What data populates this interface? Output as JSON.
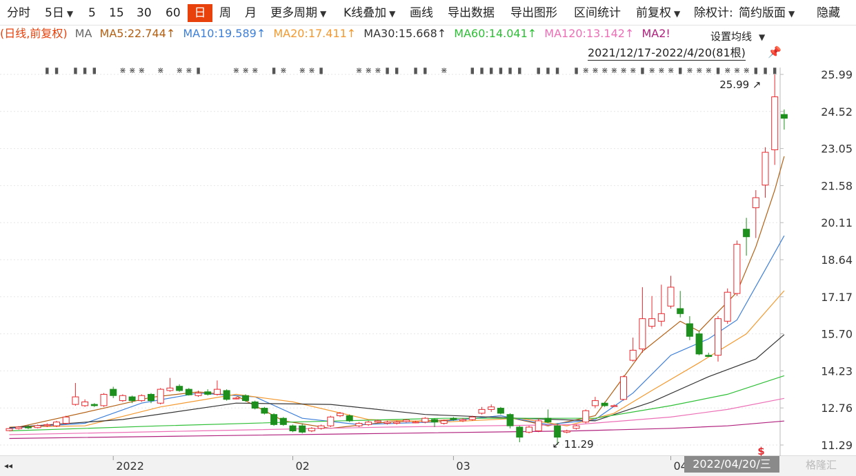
{
  "toolbar": {
    "items": [
      "分时",
      "5日",
      "5",
      "15",
      "30",
      "60",
      "日",
      "周",
      "月",
      "更多周期",
      "K线叠加",
      "画线",
      "导出数据",
      "导出图形",
      "区间统计",
      "前复权",
      "除权计:",
      "简约版面",
      "隐藏"
    ],
    "active": "日"
  },
  "legend": {
    "prefix": "(日线,前复权)",
    "ma_label": "MA",
    "ma5": "MA5:22.744↑",
    "ma10": "MA10:19.589↑",
    "ma20": "MA20:17.411↑",
    "ma30": "MA30:15.668↑",
    "ma60": "MA60:14.041↑",
    "ma120": "MA120:13.142↑",
    "ma250": "MA2!"
  },
  "set_ma_label": "设置均线",
  "date_range": "2021/12/17-2022/4/20(81根)",
  "cursor_date": "2022/04/20/三",
  "watermark": "格隆汇",
  "colors": {
    "up": "#e8292e",
    "down": "#1d8f1d",
    "ma5": "#b35f12",
    "ma10": "#3d7fd9",
    "ma20": "#f3992f",
    "ma30": "#333333",
    "ma60": "#2ebf36",
    "ma120": "#ec6fb6",
    "ma250": "#b0207d",
    "accent": "#e8410b"
  },
  "chart_data": {
    "type": "candlestick",
    "y_ticks": [
      25.99,
      24.52,
      23.05,
      21.58,
      20.11,
      18.64,
      17.17,
      15.7,
      14.23,
      12.76,
      11.29
    ],
    "ylim": [
      11.29,
      25.99
    ],
    "x_labels": [
      "2022",
      "02",
      "03",
      "04"
    ],
    "x_label_index": [
      11,
      30,
      47,
      70
    ],
    "annotations": [
      {
        "text": "25.99",
        "index": 80,
        "value": 25.99
      },
      {
        "text": "11.29",
        "index": 57,
        "value": 11.29
      }
    ],
    "candles": [
      [
        11.86,
        11.94,
        11.96,
        11.84
      ],
      [
        11.94,
        12.0,
        12.04,
        11.9
      ],
      [
        12.0,
        11.98,
        12.08,
        11.92
      ],
      [
        11.98,
        12.06,
        12.1,
        11.95
      ],
      [
        12.06,
        12.1,
        12.15,
        12.0
      ],
      [
        12.05,
        12.2,
        12.25,
        12.0
      ],
      [
        12.15,
        12.4,
        12.45,
        12.1
      ],
      [
        12.9,
        13.2,
        13.75,
        12.85
      ],
      [
        12.85,
        13.0,
        13.1,
        12.8
      ],
      [
        12.9,
        12.85,
        12.95,
        12.8
      ],
      [
        12.85,
        13.3,
        13.35,
        12.8
      ],
      [
        13.5,
        13.25,
        13.6,
        13.15
      ],
      [
        13.05,
        13.25,
        13.3,
        13.0
      ],
      [
        13.2,
        13.05,
        13.25,
        12.95
      ],
      [
        13.05,
        13.25,
        13.3,
        13.0
      ],
      [
        13.3,
        13.05,
        13.35,
        12.95
      ],
      [
        12.95,
        13.5,
        13.55,
        12.9
      ],
      [
        13.45,
        13.55,
        13.95,
        13.4
      ],
      [
        13.62,
        13.45,
        13.7,
        13.4
      ],
      [
        13.5,
        13.28,
        13.55,
        13.25
      ],
      [
        13.25,
        13.35,
        13.45,
        13.2
      ],
      [
        13.4,
        13.3,
        13.5,
        13.25
      ],
      [
        13.3,
        13.5,
        13.85,
        13.25
      ],
      [
        13.45,
        13.1,
        13.5,
        13.05
      ],
      [
        13.15,
        13.15,
        13.2,
        13.1
      ],
      [
        13.25,
        13.05,
        13.3,
        13.0
      ],
      [
        13.0,
        12.75,
        13.05,
        12.7
      ],
      [
        12.75,
        12.55,
        12.8,
        12.5
      ],
      [
        12.5,
        12.1,
        12.55,
        12.05
      ],
      [
        12.35,
        12.1,
        12.4,
        12.05
      ],
      [
        12.05,
        11.85,
        12.1,
        11.8
      ],
      [
        12.05,
        11.8,
        12.15,
        11.75
      ],
      [
        11.85,
        11.95,
        12.0,
        11.8
      ],
      [
        11.95,
        12.05,
        12.1,
        11.9
      ],
      [
        12.05,
        12.4,
        12.45,
        12.0
      ],
      [
        12.45,
        12.55,
        12.6,
        12.4
      ],
      [
        12.45,
        12.25,
        12.5,
        12.2
      ],
      [
        12.05,
        12.15,
        12.2,
        12.0
      ],
      [
        12.1,
        12.2,
        12.25,
        12.05
      ],
      [
        12.2,
        12.25,
        12.3,
        12.15
      ],
      [
        12.15,
        12.2,
        12.25,
        12.1
      ],
      [
        12.15,
        12.2,
        12.25,
        12.1
      ],
      [
        12.22,
        12.28,
        12.32,
        12.18
      ],
      [
        12.2,
        12.2,
        12.25,
        12.15
      ],
      [
        12.2,
        12.35,
        12.4,
        12.15
      ],
      [
        12.3,
        12.2,
        12.35,
        12.0
      ],
      [
        12.15,
        12.25,
        12.3,
        12.1
      ],
      [
        12.35,
        12.3,
        12.4,
        12.25
      ],
      [
        12.25,
        12.3,
        12.35,
        12.2
      ],
      [
        12.3,
        12.4,
        12.45,
        12.25
      ],
      [
        12.55,
        12.7,
        12.8,
        12.5
      ],
      [
        12.7,
        12.8,
        12.9,
        12.6
      ],
      [
        12.75,
        12.55,
        12.8,
        12.5
      ],
      [
        12.5,
        12.05,
        12.55,
        11.95
      ],
      [
        12.0,
        11.6,
        12.05,
        11.4
      ],
      [
        11.8,
        12.0,
        12.05,
        11.75
      ],
      [
        11.85,
        12.25,
        12.35,
        11.8
      ],
      [
        12.35,
        12.2,
        12.7,
        12.15
      ],
      [
        12.05,
        11.6,
        12.15,
        11.29
      ],
      [
        11.8,
        11.85,
        11.9,
        11.75
      ],
      [
        11.95,
        12.05,
        12.1,
        11.9
      ],
      [
        12.2,
        12.65,
        12.7,
        12.15
      ],
      [
        12.85,
        13.05,
        13.2,
        12.75
      ],
      [
        12.95,
        12.85,
        13.0,
        12.8
      ],
      [
        12.85,
        12.85,
        12.9,
        12.8
      ],
      [
        13.1,
        14.0,
        14.05,
        13.05
      ],
      [
        14.65,
        15.05,
        15.55,
        14.6
      ],
      [
        15.1,
        16.3,
        17.55,
        14.95
      ],
      [
        16.0,
        16.3,
        17.2,
        15.9
      ],
      [
        16.2,
        16.5,
        17.65,
        16.0
      ],
      [
        16.8,
        17.55,
        18.0,
        16.7
      ],
      [
        16.7,
        16.5,
        17.4,
        16.35
      ],
      [
        16.1,
        15.6,
        16.4,
        15.45
      ],
      [
        15.7,
        14.9,
        15.8,
        14.85
      ],
      [
        14.85,
        14.8,
        14.95,
        14.8
      ],
      [
        14.85,
        16.3,
        16.4,
        14.6
      ],
      [
        16.2,
        17.35,
        17.5,
        16.1
      ],
      [
        17.3,
        19.25,
        19.4,
        17.2
      ],
      [
        19.85,
        19.55,
        20.3,
        18.8
      ],
      [
        20.7,
        21.1,
        21.4,
        19.5
      ],
      [
        21.6,
        22.9,
        23.1,
        21.1
      ],
      [
        23.0,
        25.1,
        25.99,
        22.4
      ],
      [
        24.4,
        24.25,
        24.6,
        23.8
      ]
    ],
    "ma_lines": {
      "ma5": [
        [
          0,
          11.92
        ],
        [
          10,
          12.75
        ],
        [
          15,
          13.18
        ],
        [
          20,
          13.4
        ],
        [
          24,
          13.25
        ],
        [
          29,
          12.25
        ],
        [
          34,
          11.95
        ],
        [
          40,
          12.2
        ],
        [
          48,
          12.3
        ],
        [
          52,
          12.45
        ],
        [
          57,
          12.05
        ],
        [
          62,
          12.45
        ],
        [
          67,
          15.0
        ],
        [
          71,
          16.2
        ],
        [
          73,
          15.8
        ],
        [
          77,
          17.35
        ],
        [
          79,
          19.15
        ],
        [
          81,
          21.4
        ],
        [
          82,
          22.74
        ]
      ],
      "ma10": [
        [
          0,
          11.95
        ],
        [
          8,
          12.15
        ],
        [
          14,
          12.95
        ],
        [
          20,
          13.35
        ],
        [
          26,
          13.2
        ],
        [
          31,
          12.35
        ],
        [
          37,
          12.1
        ],
        [
          45,
          12.2
        ],
        [
          52,
          12.45
        ],
        [
          57,
          12.1
        ],
        [
          62,
          12.3
        ],
        [
          66,
          13.35
        ],
        [
          70,
          14.85
        ],
        [
          74,
          15.5
        ],
        [
          77,
          16.25
        ],
        [
          80,
          18.25
        ],
        [
          82,
          19.59
        ]
      ],
      "ma20": [
        [
          0,
          12.0
        ],
        [
          8,
          12.05
        ],
        [
          16,
          12.8
        ],
        [
          24,
          13.3
        ],
        [
          30,
          13.0
        ],
        [
          38,
          12.3
        ],
        [
          46,
          12.2
        ],
        [
          54,
          12.35
        ],
        [
          59,
          12.05
        ],
        [
          64,
          12.55
        ],
        [
          68,
          13.45
        ],
        [
          73,
          14.55
        ],
        [
          78,
          15.7
        ],
        [
          82,
          17.41
        ]
      ],
      "ma30": [
        [
          0,
          11.98
        ],
        [
          12,
          12.3
        ],
        [
          24,
          12.95
        ],
        [
          34,
          12.9
        ],
        [
          44,
          12.5
        ],
        [
          54,
          12.35
        ],
        [
          62,
          12.25
        ],
        [
          68,
          13.0
        ],
        [
          74,
          14.0
        ],
        [
          79,
          14.7
        ],
        [
          82,
          15.67
        ]
      ],
      "ma60": [
        [
          0,
          11.85
        ],
        [
          16,
          12.05
        ],
        [
          30,
          12.2
        ],
        [
          46,
          12.35
        ],
        [
          62,
          12.35
        ],
        [
          70,
          12.85
        ],
        [
          76,
          13.3
        ],
        [
          82,
          14.04
        ]
      ],
      "ma120": [
        [
          0,
          11.7
        ],
        [
          20,
          11.85
        ],
        [
          40,
          12.0
        ],
        [
          60,
          12.1
        ],
        [
          70,
          12.4
        ],
        [
          76,
          12.7
        ],
        [
          82,
          13.14
        ]
      ],
      "ma250": [
        [
          0,
          11.55
        ],
        [
          20,
          11.65
        ],
        [
          40,
          11.75
        ],
        [
          60,
          11.85
        ],
        [
          70,
          11.95
        ],
        [
          76,
          12.05
        ],
        [
          82,
          12.24
        ]
      ]
    },
    "markers": {
      "index": [
        4,
        5,
        7,
        8,
        9,
        12,
        13,
        14,
        16,
        18,
        19,
        20,
        24,
        25,
        26,
        28,
        29,
        31,
        32,
        33,
        37,
        38,
        39,
        40,
        41,
        43,
        44,
        46,
        49,
        50,
        51,
        52,
        53,
        54,
        56,
        57,
        58,
        60,
        61,
        62,
        63,
        64,
        65,
        66,
        67,
        68,
        69,
        70,
        71,
        72,
        73,
        74,
        75,
        76,
        77,
        78,
        79,
        80,
        81
      ],
      "glyphs": [
        "▮",
        "▮",
        "▮",
        "▮",
        "▮",
        "⋇",
        "⋇",
        "⋇",
        "⋇",
        "⋇",
        "⋇",
        "▮",
        "⋇",
        "⋇",
        "⋇",
        "▮",
        "⋇",
        "⋇",
        "⋇",
        "▮",
        "⋇",
        "⋇",
        "⋇",
        "▮",
        "▮",
        "▮",
        "▮",
        "⋇",
        "▮",
        "▮",
        "▮",
        "▮",
        "▮"
      ]
    },
    "s_marker": {
      "text": "$",
      "index": 80
    }
  }
}
